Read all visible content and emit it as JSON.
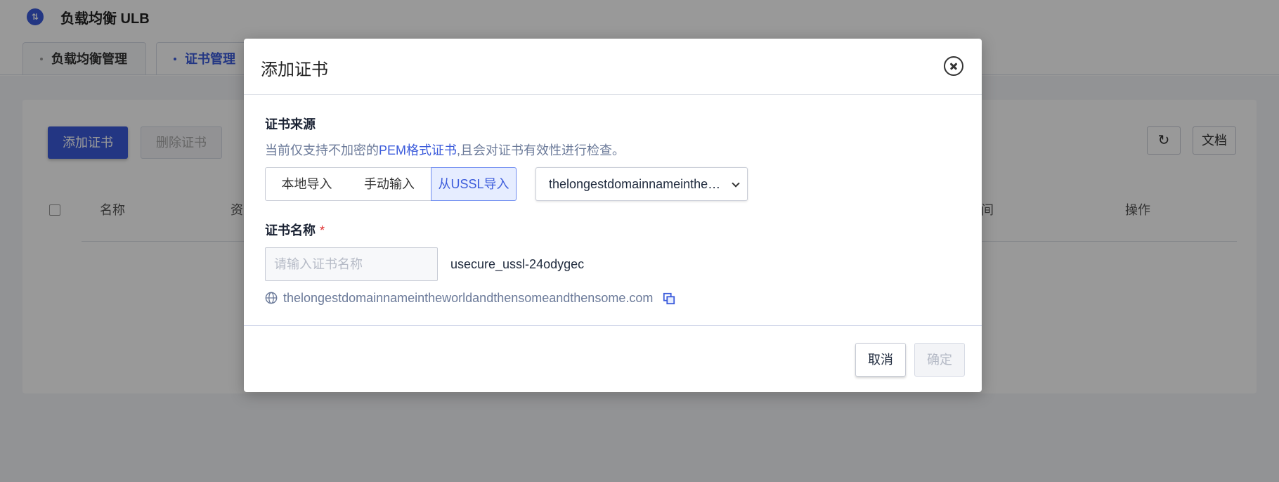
{
  "app": {
    "title": "负载均衡 ULB",
    "logo_glyph": "⇅"
  },
  "tabs": [
    {
      "label": "负载均衡管理",
      "active": false
    },
    {
      "label": "证书管理",
      "active": true
    }
  ],
  "toolbar": {
    "add_label": "添加证书",
    "delete_label": "删除证书",
    "refresh_icon": "↻",
    "doc_label": "文档"
  },
  "table": {
    "headers": [
      "名称",
      "资",
      "间",
      "操作"
    ]
  },
  "modal": {
    "title": "添加证书",
    "source_label": "证书来源",
    "hint_prefix": "当前仅支持不加密的",
    "hint_link": "PEM格式证书",
    "hint_suffix": ",且会对证书有效性进行检查。",
    "source_options": [
      "本地导入",
      "手动输入",
      "从USSL导入"
    ],
    "selected_source": "从USSL导入",
    "ussl_select_value": "thelongestdomainnameintheworldandthensomeandthensome.com",
    "name_label": "证书名称",
    "required_mark": "*",
    "name_placeholder": "请输入证书名称",
    "name_value": "",
    "name_suffix": "usecure_ussl-24odygec",
    "domain": "thelongestdomainnameintheworldandthensomeandthensome.com",
    "cancel_label": "取消",
    "ok_label": "确定"
  },
  "colors": {
    "accent": "#3b5bdb",
    "hint_text": "#6b7a99",
    "overlay": "rgba(0,0,0,0.40)"
  }
}
